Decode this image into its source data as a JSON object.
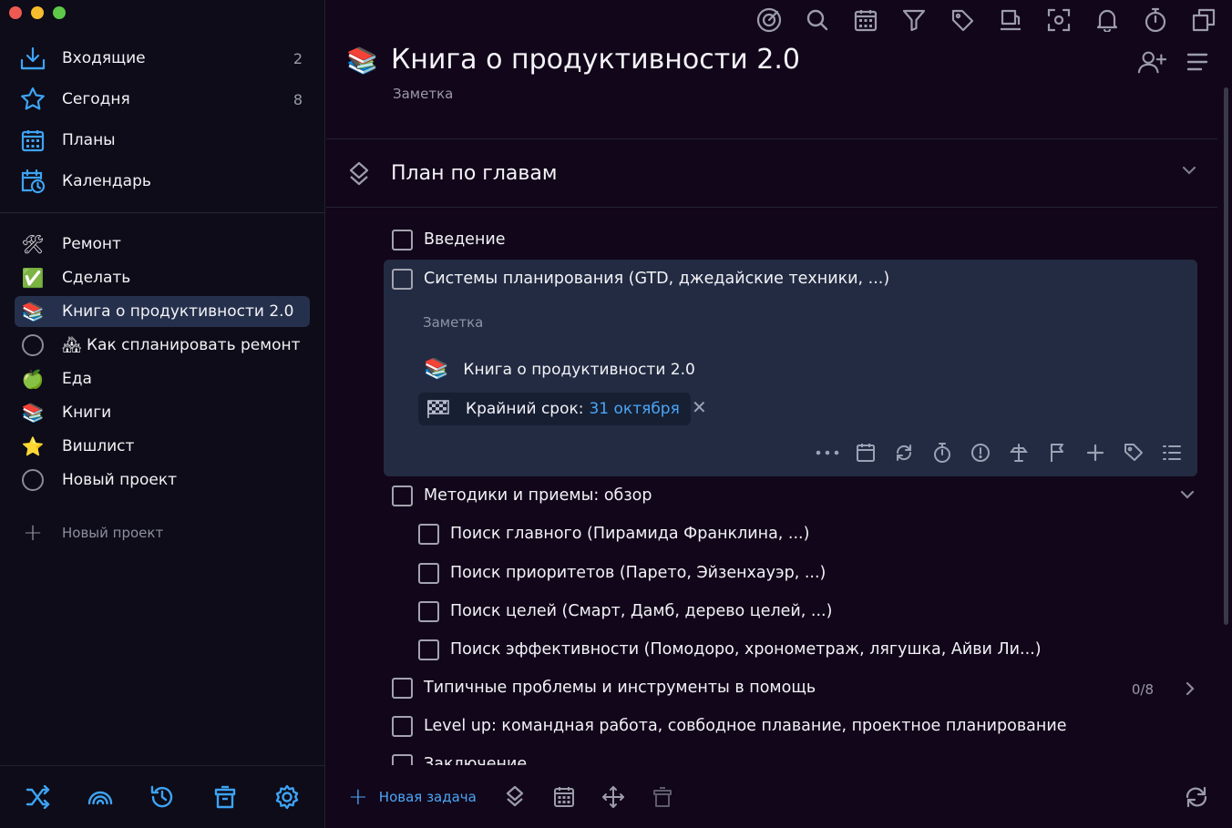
{
  "sidebar": {
    "nav": [
      {
        "label": "Входящие",
        "count": "2",
        "icon": "inbox-icon"
      },
      {
        "label": "Сегодня",
        "count": "8",
        "icon": "star-icon"
      },
      {
        "label": "Планы",
        "count": "",
        "icon": "calendar-grid-icon"
      },
      {
        "label": "Календарь",
        "count": "",
        "icon": "calendar-clock-icon"
      }
    ],
    "projects": [
      {
        "label": "Ремонт",
        "icon": "🛠"
      },
      {
        "label": "Сделать",
        "icon": "✅"
      },
      {
        "label": "Книга о продуктивности 2.0",
        "icon": "📚"
      },
      {
        "label": "🏘 Как спланировать ремонт",
        "icon": "circle"
      },
      {
        "label": "Еда",
        "icon": "🍏"
      },
      {
        "label": "Книги",
        "icon": "📚"
      },
      {
        "label": "Вишлист",
        "icon": "⭐"
      },
      {
        "label": "Новый проект",
        "icon": "circle"
      }
    ],
    "new_project_label": "Новый проект"
  },
  "page": {
    "icon": "📚",
    "title": "Книга о продуктивности 2.0",
    "note_label": "Заметка"
  },
  "section": {
    "title": "План по главам"
  },
  "tasks": {
    "t1": "Введение",
    "t2": "Системы планирования (GTD, джедайские техники, ...)",
    "t2_note": "Заметка",
    "t2_link": "Книга о продуктивности 2.0",
    "t2_link_icon": "📚",
    "t2_deadline_label": "Крайний срок:",
    "t2_deadline_value": "31 октября",
    "t3": "Методики и приемы: обзор",
    "t3a": "Поиск главного (Пирамида Франклина, ...)",
    "t3b": "Поиск приоритетов (Парето, Эйзенхауэр, ...)",
    "t3c": "Поиск целей (Смарт, Дамб, дерево целей, ...)",
    "t3d": "Поиск эффективности (Помодоро, хронометраж, лягушка, Айви Ли...)",
    "t4": "Типичные проблемы и инструменты в помощь",
    "t4_count": "0/8",
    "t5": "Level up: командная работа, совбодное плавание, проектное планирование",
    "t6": "Заключение"
  },
  "bottombar": {
    "new_task_label": "Новая задача"
  },
  "colors": {
    "accent": "#4aa6f5",
    "sidebar_bg": "#0d0c18",
    "main_bg": "#12061a",
    "selected_project_bg": "#25304c",
    "expanded_task_bg": "#222b42"
  }
}
